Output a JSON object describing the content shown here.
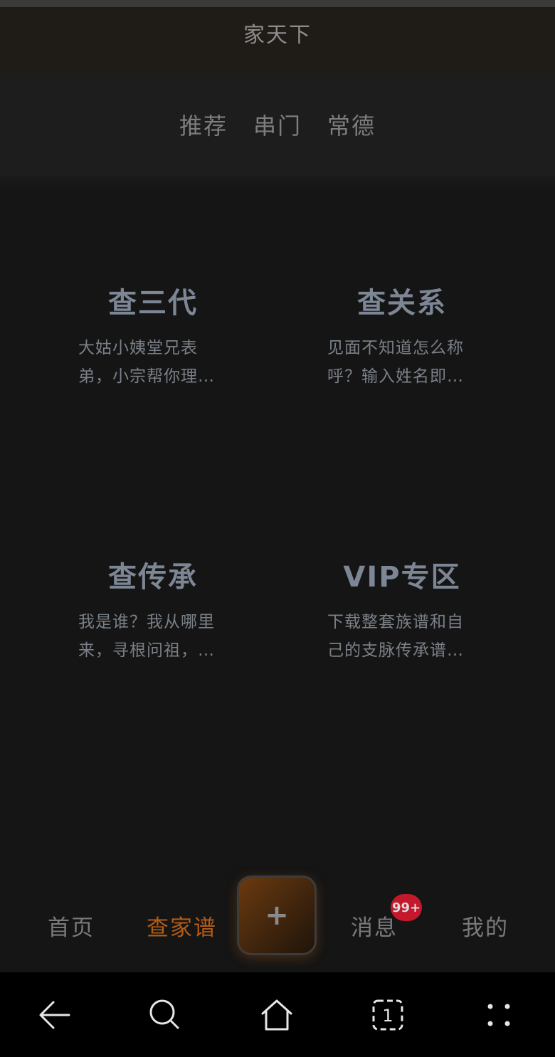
{
  "header": {
    "title": "家天下"
  },
  "tabs": [
    {
      "label": "推荐"
    },
    {
      "label": "串门"
    },
    {
      "label": "常德"
    }
  ],
  "cards": [
    {
      "title": "查三代",
      "desc_line1": "大姑小姨堂兄表",
      "desc_line2": "弟，小宗帮你理…"
    },
    {
      "title": "查关系",
      "desc_line1": "见面不知道怎么称",
      "desc_line2": "呼？输入姓名即…"
    },
    {
      "title": "查传承",
      "desc_line1": "我是谁？我从哪里",
      "desc_line2": "来，寻根问祖，…"
    },
    {
      "title": "VIP专区",
      "desc_line1": "下载整套族谱和自",
      "desc_line2": "己的支脉传承谱…"
    }
  ],
  "bottom_nav": {
    "home": "首页",
    "genealogy": "查家谱",
    "plus": "+",
    "messages": "消息",
    "messages_badge": "99+",
    "mine": "我的",
    "active_color": "#b35c16",
    "badge_color": "#c4182c"
  },
  "system_nav": {
    "icons": [
      "back-arrow-icon",
      "search-icon",
      "home-icon",
      "tabs-icon",
      "menu-dots-icon"
    ],
    "tabs_count": "1"
  }
}
